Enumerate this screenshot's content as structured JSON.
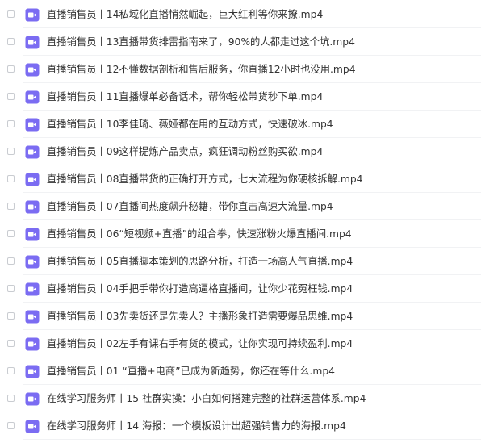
{
  "icon": "video-file-icon",
  "colors": {
    "icon": "#7b6cf2",
    "text": "#333333",
    "divider": "#f1f2f4",
    "checkbox_border": "#c9ccd1"
  },
  "files": [
    {
      "name": "直播销售员丨14私域化直播悄然崛起，巨大红利等你来撩.mp4"
    },
    {
      "name": "直播销售员丨13直播带货排雷指南来了，90%的人都走过这个坑.mp4"
    },
    {
      "name": "直播销售员丨12不懂数据剖析和售后服务，你直播12小时也没用.mp4"
    },
    {
      "name": "直播销售员丨11直播爆单必备话术，帮你轻松带货秒下单.mp4"
    },
    {
      "name": "直播销售员丨10李佳琦、薇娅都在用的互动方式，快速破冰.mp4"
    },
    {
      "name": "直播销售员丨09这样提炼产品卖点，疯狂调动粉丝购买欲.mp4"
    },
    {
      "name": "直播销售员丨08直播带货的正确打开方式，七大流程为你硬核拆解.mp4"
    },
    {
      "name": "直播销售员丨07直播间热度飙升秘籍，带你直击高速大流量.mp4"
    },
    {
      "name": "直播销售员丨06“短视频+直播”的组合拳，快速涨粉火爆直播间.mp4"
    },
    {
      "name": "直播销售员丨05直播脚本策划的思路分析，打造一场高人气直播.mp4"
    },
    {
      "name": "直播销售员丨04手把手带你打造高逼格直播间，让你少花冤枉钱.mp4"
    },
    {
      "name": "直播销售员丨03先卖货还是先卖人？主播形象打造需要爆品思维.mp4"
    },
    {
      "name": "直播销售员丨02左手有课右手有货的模式，让你实现可持续盈利.mp4"
    },
    {
      "name": "直播销售员丨01 “直播+电商”已成为新趋势，你还在等什么.mp4"
    },
    {
      "name": "在线学习服务师丨15 社群实操：小白如何搭建完整的社群运营体系.mp4"
    },
    {
      "name": "在线学习服务师丨14 海报：一个模板设计出超强销售力的海报.mp4"
    }
  ]
}
